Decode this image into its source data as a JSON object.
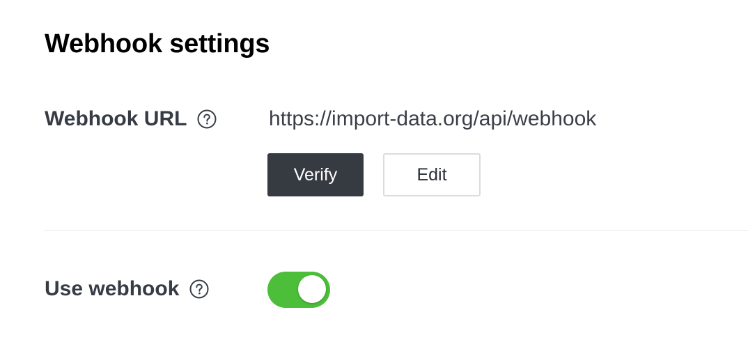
{
  "page": {
    "title": "Webhook settings"
  },
  "webhook_url": {
    "label": "Webhook URL",
    "help_icon": "question-circle-icon",
    "value": "https://import-data.org/api/webhook",
    "verify_label": "Verify",
    "edit_label": "Edit"
  },
  "use_webhook": {
    "label": "Use webhook",
    "help_icon": "question-circle-icon",
    "enabled": true
  },
  "colors": {
    "primary_button": "#363a41",
    "toggle_on": "#4cbe3a",
    "divider": "#e6e8eb"
  }
}
